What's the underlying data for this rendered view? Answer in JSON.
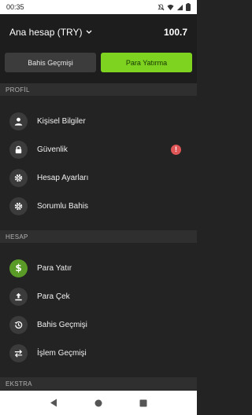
{
  "status_bar": {
    "time": "00:35"
  },
  "account": {
    "name": "Ana hesap (TRY)",
    "balance": "100.7"
  },
  "actions": {
    "bet_history": "Bahis Geçmişi",
    "deposit": "Para Yatırma"
  },
  "sections": {
    "profile": {
      "title": "PROFİL",
      "items": [
        {
          "label": "Kişisel Bilgiler",
          "icon": "person-icon"
        },
        {
          "label": "Güvenlik",
          "icon": "lock-icon",
          "alert": "!"
        },
        {
          "label": "Hesap Ayarları",
          "icon": "gear-icon"
        },
        {
          "label": "Sorumlu Bahis",
          "icon": "gear-icon"
        }
      ]
    },
    "account": {
      "title": "HESAP",
      "items": [
        {
          "label": "Para Yatır",
          "icon": "dollar-icon"
        },
        {
          "label": "Para Çek",
          "icon": "upload-icon"
        },
        {
          "label": "Bahis Geçmişi",
          "icon": "history-icon"
        },
        {
          "label": "İşlem Geçmişi",
          "icon": "transfer-icon"
        }
      ]
    },
    "extra": {
      "title": "EKSTRA"
    }
  },
  "colors": {
    "accent": "#7ed321",
    "alert": "#e05555",
    "background": "#232323"
  }
}
